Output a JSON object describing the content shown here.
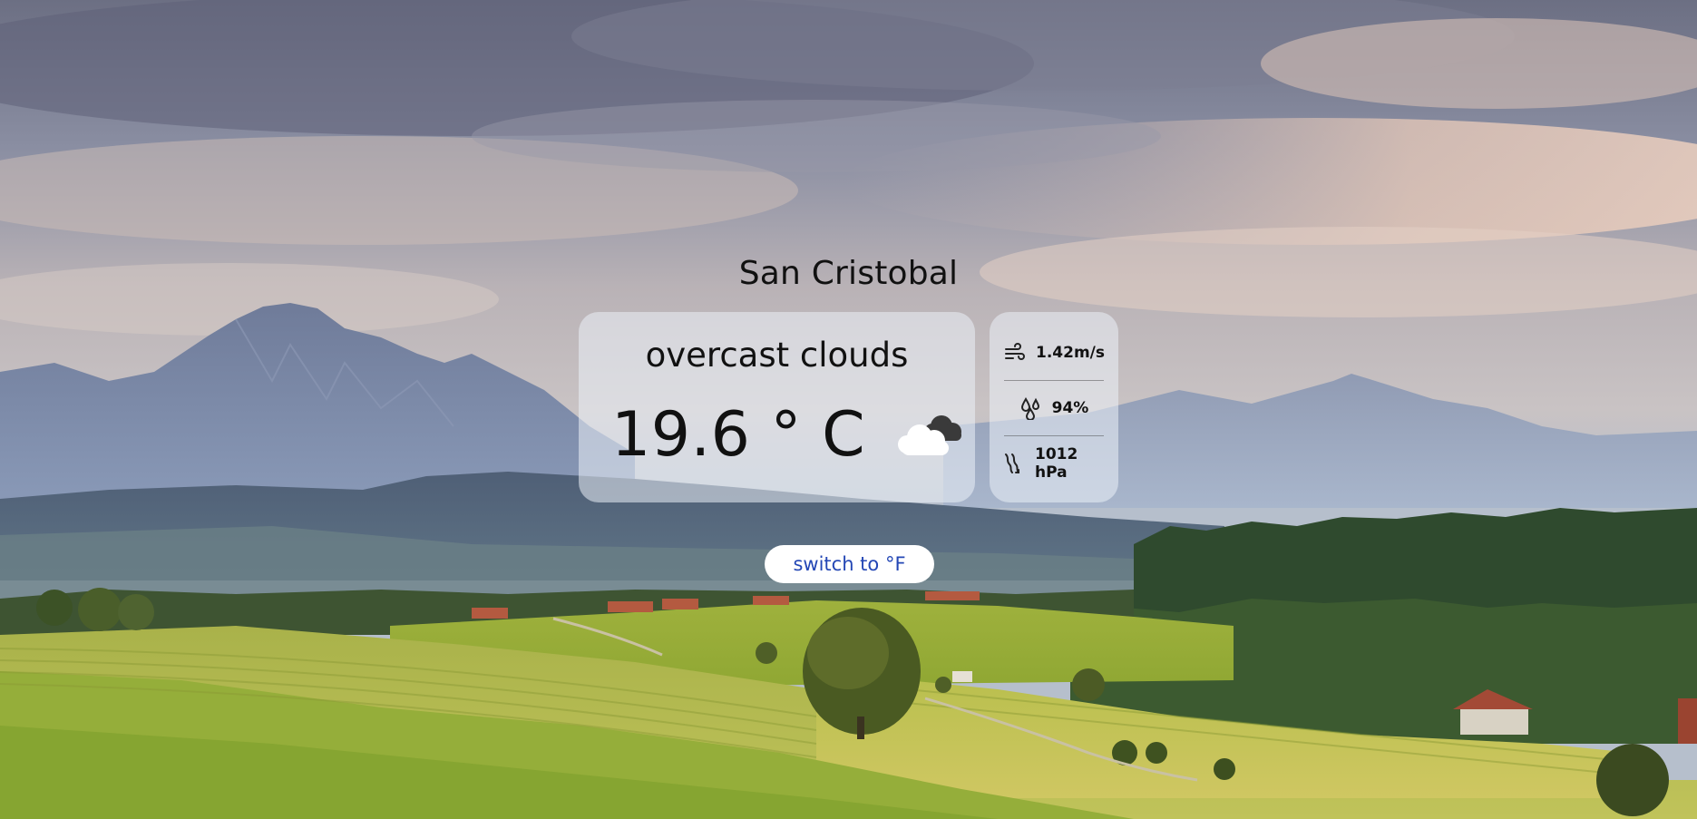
{
  "location": {
    "city": "San Cristobal"
  },
  "weather": {
    "description": "overcast clouds",
    "temperature": "19.6 ° C",
    "condition_icon": "cloudy-icon"
  },
  "details": {
    "wind": {
      "icon": "wind-icon",
      "value": "1.42m/s"
    },
    "humidity": {
      "icon": "humidity-icon",
      "value": "94%"
    },
    "pressure": {
      "icon": "pressure-icon",
      "value": "1012 hPa"
    }
  },
  "controls": {
    "switch_unit_label": "switch to °F"
  },
  "colors": {
    "card_bg": "#ebf0f8",
    "button_text": "#2447b5",
    "text": "#111111"
  }
}
